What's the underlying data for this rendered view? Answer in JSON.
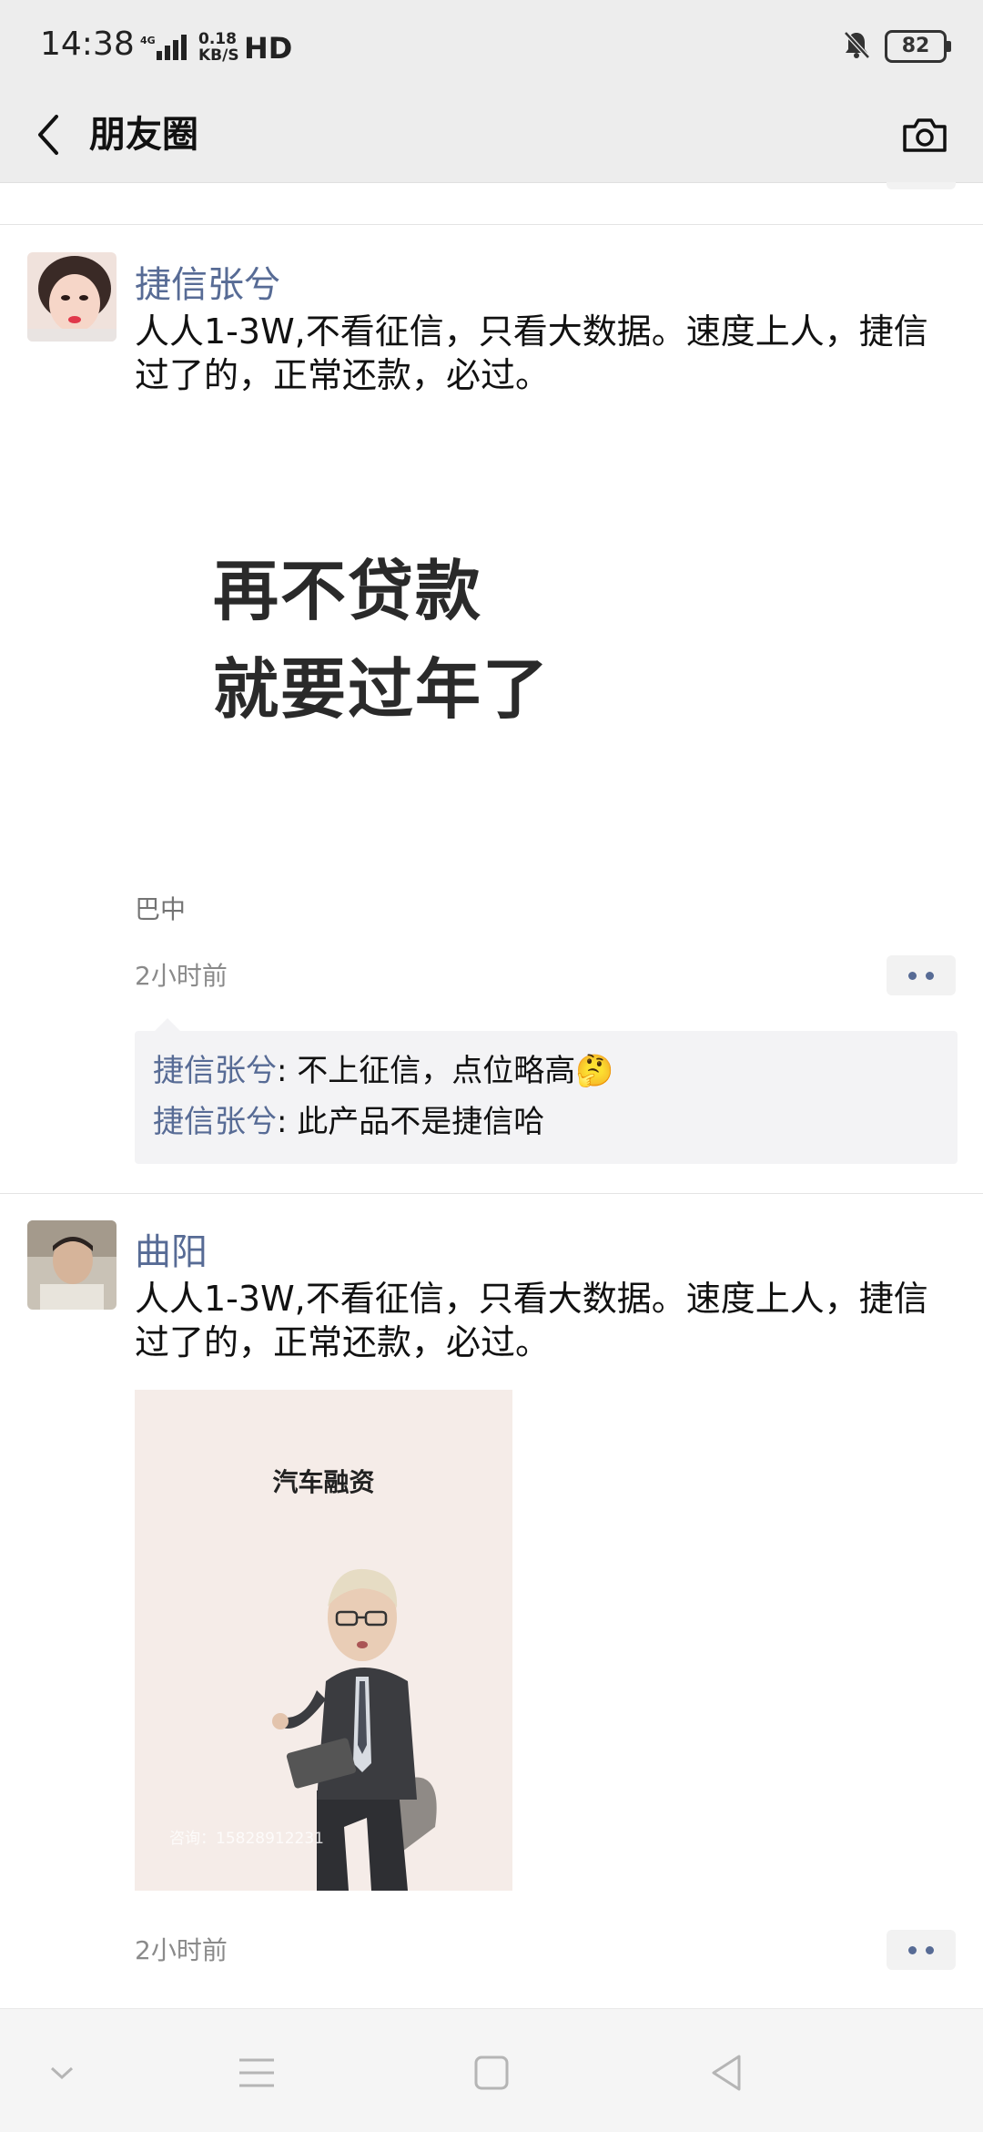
{
  "status": {
    "time": "14:38",
    "network": "4G",
    "speed_value": "0.18",
    "speed_unit": "KB/S",
    "hd": "HD",
    "battery": "82"
  },
  "nav": {
    "title": "朋友圈"
  },
  "posts": [
    {
      "user": "捷信张兮",
      "text": "人人1-3W,不看征信，只看大数据。速度上人，捷信过了的，正常还款，必过。",
      "image_lines": [
        "再不贷款",
        "就要过年了"
      ],
      "location": "巴中",
      "time": "2小时前",
      "comments": [
        {
          "user": "捷信张兮",
          "sep": ": ",
          "text": "不上征信，点位略高🤔"
        },
        {
          "user": "捷信张兮",
          "sep": ": ",
          "text": "此产品不是捷信哈"
        }
      ]
    },
    {
      "user": "曲阳",
      "text": "人人1-3W,不看征信，只看大数据。速度上人，捷信过了的，正常还款，必过。",
      "image_title": "汽车融资",
      "image_watermark": "咨询：15828912231",
      "time": "2小时前"
    }
  ],
  "icons": {
    "back": "back-chevron-icon",
    "camera": "camera-icon",
    "more": "more-dots-icon",
    "mute": "bell-mute-icon"
  },
  "colors": {
    "link": "#576b95",
    "bar": "#ededed"
  }
}
